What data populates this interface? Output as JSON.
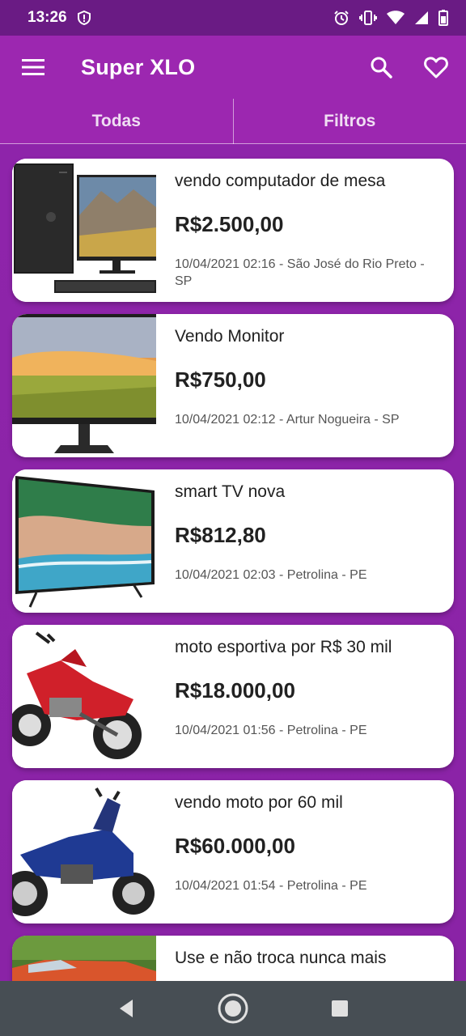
{
  "status_bar": {
    "time": "13:26",
    "icons": [
      "shield-alert-icon",
      "alarm-icon",
      "vibrate-icon",
      "wifi-icon",
      "signal-icon",
      "battery-icon"
    ]
  },
  "app_bar": {
    "title": "Super XLO",
    "icons": [
      "menu-icon",
      "search-icon",
      "heart-icon"
    ]
  },
  "tabs": [
    {
      "label": "Todas"
    },
    {
      "label": "Filtros"
    }
  ],
  "listings": [
    {
      "title": "vendo computador de mesa",
      "price": "R$2.500,00",
      "meta": "10/04/2021 02:16 - São José do Rio Preto - SP",
      "image": "desktop-computer-image"
    },
    {
      "title": "Vendo Monitor",
      "price": "R$750,00",
      "meta": "10/04/2021 02:12 - Artur Nogueira - SP",
      "image": "monitor-image"
    },
    {
      "title": "smart TV nova",
      "price": "R$812,80",
      "meta": "10/04/2021 02:03 - Petrolina - PE",
      "image": "smart-tv-image"
    },
    {
      "title": "moto esportiva por R$ 30 mil",
      "price": "R$18.000,00",
      "meta": "10/04/2021 01:56 - Petrolina - PE",
      "image": "red-motorcycle-image"
    },
    {
      "title": "vendo moto por 60 mil",
      "price": "R$60.000,00",
      "meta": "10/04/2021 01:54 - Petrolina - PE",
      "image": "blue-motorcycle-image"
    },
    {
      "title": "Use e não troca nunca mais",
      "price": "",
      "meta": "",
      "image": "car-image"
    }
  ],
  "nav_bar": {
    "icons": [
      "back-icon",
      "home-icon",
      "recents-icon"
    ]
  },
  "colors": {
    "primary": "#9c27b0",
    "status_bar": "#6a1b84",
    "background": "#8e24aa",
    "nav_bar": "#474e54"
  }
}
